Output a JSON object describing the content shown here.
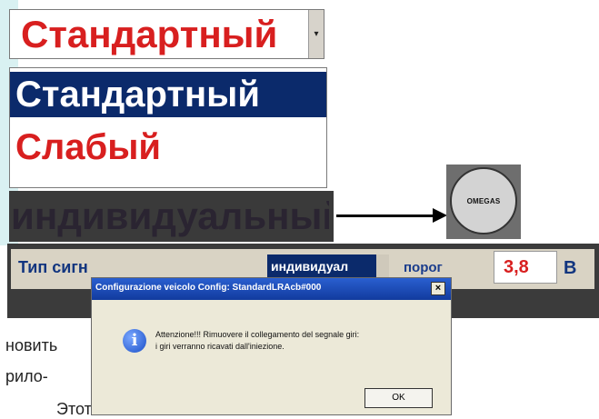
{
  "dropdown": {
    "current_value": "Стандартный",
    "arrow": "▾",
    "options": [
      "Стандартный",
      "Слабый",
      "индивидуальный"
    ]
  },
  "logo": {
    "text": "OMEGAS"
  },
  "settings": {
    "signal_label": "Тип сигн",
    "signal_value": "индивидуал",
    "threshold_label": "порог",
    "threshold_value": "3,8",
    "unit": "В"
  },
  "dialog": {
    "title": "Configurazione veicolo   Config: StandardLRAcb#000",
    "close_label": "×",
    "message_line1": "Attenzione!!! Rimuovere il collegamento del segnale giri:",
    "message_line2": "i giri verranno ricavati dall'iniezione.",
    "ok_label": "OK"
  },
  "page_text": {
    "line1": "новить",
    "line2": "рило-",
    "line3": "Этот"
  },
  "colors": {
    "accent_red": "#d81f1f",
    "selection_blue": "#0b2a6b",
    "label_blue": "#12357f"
  }
}
